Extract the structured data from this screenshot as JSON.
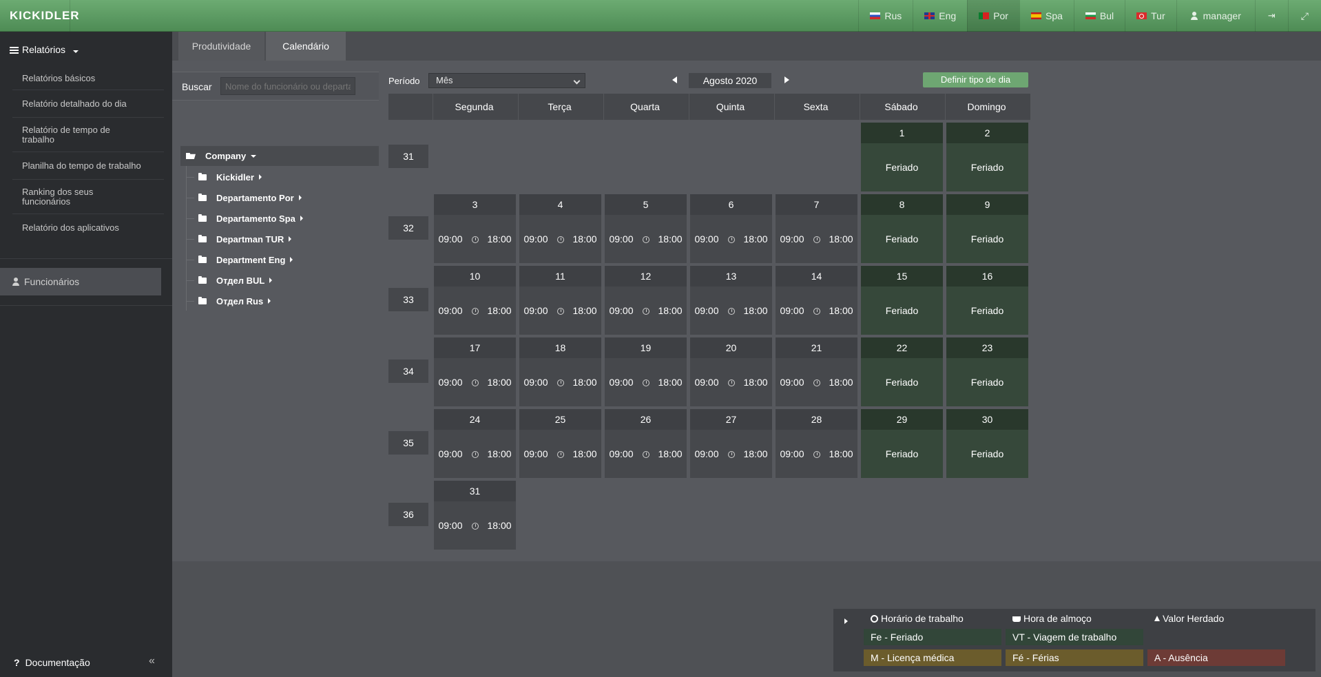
{
  "topbar": {
    "logo": "KICKIDLER",
    "languages": [
      {
        "code": "ru",
        "label": "Rus"
      },
      {
        "code": "en",
        "label": "Eng"
      },
      {
        "code": "pt",
        "label": "Por"
      },
      {
        "code": "es",
        "label": "Spa"
      },
      {
        "code": "bg",
        "label": "Bul"
      },
      {
        "code": "tr",
        "label": "Tur"
      }
    ],
    "active_language": "Por",
    "user": "manager"
  },
  "sidebar": {
    "header": "Relatórios",
    "items": [
      "Relatórios básicos",
      "Relatório detalhado do dia",
      "Relatório de tempo de trabalho",
      "Planilha do tempo de trabalho",
      "Ranking dos seus funcionários",
      "Relatório dos aplicativos"
    ],
    "employees": "Funcionários",
    "documentation": "Documentação"
  },
  "tabs": [
    "Produtividade",
    "Calendário"
  ],
  "active_tab": "Calendário",
  "search": {
    "label": "Buscar",
    "placeholder": "Nome do funcionário ou departamento"
  },
  "tree": {
    "root": "Company",
    "children": [
      "Kickidler",
      "Departamento Por",
      "Departamento Spa",
      "Departman TUR",
      "Department Eng",
      "Отдел BUL",
      "Отдел Rus"
    ]
  },
  "period": {
    "label": "Período",
    "value": "Mês"
  },
  "month": "Agosto 2020",
  "define_button": "Definir tipo de dia",
  "weekdays": [
    "Segunda",
    "Terça",
    "Quarta",
    "Quinta",
    "Sexta",
    "Sábado",
    "Domingo"
  ],
  "weeks": [
    {
      "num": "31",
      "days": [
        null,
        null,
        null,
        null,
        null,
        {
          "d": "1",
          "t": "Feriado"
        },
        {
          "d": "2",
          "t": "Feriado"
        }
      ]
    },
    {
      "num": "32",
      "days": [
        {
          "d": "3",
          "s": "09:00",
          "e": "18:00"
        },
        {
          "d": "4",
          "s": "09:00",
          "e": "18:00"
        },
        {
          "d": "5",
          "s": "09:00",
          "e": "18:00"
        },
        {
          "d": "6",
          "s": "09:00",
          "e": "18:00"
        },
        {
          "d": "7",
          "s": "09:00",
          "e": "18:00"
        },
        {
          "d": "8",
          "t": "Feriado"
        },
        {
          "d": "9",
          "t": "Feriado"
        }
      ]
    },
    {
      "num": "33",
      "days": [
        {
          "d": "10",
          "s": "09:00",
          "e": "18:00"
        },
        {
          "d": "11",
          "s": "09:00",
          "e": "18:00"
        },
        {
          "d": "12",
          "s": "09:00",
          "e": "18:00"
        },
        {
          "d": "13",
          "s": "09:00",
          "e": "18:00"
        },
        {
          "d": "14",
          "s": "09:00",
          "e": "18:00"
        },
        {
          "d": "15",
          "t": "Feriado"
        },
        {
          "d": "16",
          "t": "Feriado"
        }
      ]
    },
    {
      "num": "34",
      "days": [
        {
          "d": "17",
          "s": "09:00",
          "e": "18:00"
        },
        {
          "d": "18",
          "s": "09:00",
          "e": "18:00"
        },
        {
          "d": "19",
          "s": "09:00",
          "e": "18:00"
        },
        {
          "d": "20",
          "s": "09:00",
          "e": "18:00"
        },
        {
          "d": "21",
          "s": "09:00",
          "e": "18:00"
        },
        {
          "d": "22",
          "t": "Feriado"
        },
        {
          "d": "23",
          "t": "Feriado"
        }
      ]
    },
    {
      "num": "35",
      "days": [
        {
          "d": "24",
          "s": "09:00",
          "e": "18:00"
        },
        {
          "d": "25",
          "s": "09:00",
          "e": "18:00"
        },
        {
          "d": "26",
          "s": "09:00",
          "e": "18:00"
        },
        {
          "d": "27",
          "s": "09:00",
          "e": "18:00"
        },
        {
          "d": "28",
          "s": "09:00",
          "e": "18:00"
        },
        {
          "d": "29",
          "t": "Feriado"
        },
        {
          "d": "30",
          "t": "Feriado"
        }
      ]
    },
    {
      "num": "36",
      "days": [
        {
          "d": "31",
          "s": "09:00",
          "e": "18:00"
        },
        null,
        null,
        null,
        null,
        null,
        null
      ]
    }
  ],
  "legend": {
    "work_hours": "Horário de trabalho",
    "lunch": "Hora de almoço",
    "inherited": "Valor Herdado",
    "holiday": "Fe - Feriado",
    "business_trip": "VT - Viagem de trabalho",
    "sick": "M - Licença médica",
    "vacation": "Fé - Férias",
    "absence": "A - Ausência"
  },
  "colors": {
    "brand_green": "#5a9a60",
    "holiday_cell": "#36483a",
    "legend_yellow": "#6b5c2c",
    "legend_red": "#6d3b36"
  }
}
